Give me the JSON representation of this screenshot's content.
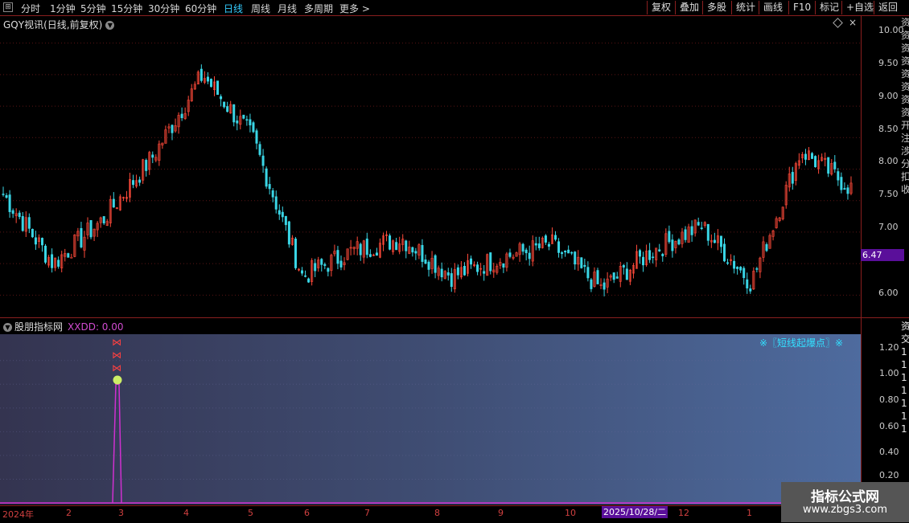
{
  "toolbar": {
    "tabs": [
      "分时",
      "1分钟",
      "5分钟",
      "15分钟",
      "30分钟",
      "60分钟",
      "日线",
      "周线",
      "月线",
      "多周期",
      "更多"
    ],
    "active_tab": "日线",
    "more_arrow": ">",
    "right_buttons": [
      "复权",
      "叠加",
      "多股",
      "统计",
      "画线",
      "F10",
      "标记",
      "+自选",
      "返回"
    ]
  },
  "main_chart": {
    "title": "GQY视讯(日线,前复权)",
    "current_price": "6.47",
    "right_strip_text": "资资资资资资资资开注涉分扣收"
  },
  "indicator": {
    "title": "股朋指标网",
    "value_label": "XXDD: 0.00",
    "signal_text": "※〖短线起爆点〗※",
    "right_strip_text": "资交1111111"
  },
  "time_axis": {
    "labels": [
      "2024年",
      "2",
      "3",
      "4",
      "5",
      "6",
      "7",
      "8",
      "9",
      "10",
      "12",
      "1"
    ],
    "cursor_date": "2025/10/28/二"
  },
  "watermark": {
    "line1": "指标公式网",
    "line2": "www.zbgs3.com"
  },
  "colors": {
    "up": "#ff4a3a",
    "down": "#3ad6e6",
    "signal_line": "#d030d0",
    "axis": "#8a1f1f",
    "tag": "#5a0f9a"
  },
  "chart_data": [
    {
      "type": "candlestick",
      "title": "GQY视讯(日线,前复权)",
      "y_ticks": [
        "10.00",
        "9.50",
        "9.00",
        "8.50",
        "8.00",
        "7.50",
        "7.00",
        "6.50",
        "6.00"
      ],
      "ylim": [
        5.8,
        10.2
      ],
      "last_price": 6.47,
      "approx_close_path": [
        {
          "t": "2024-01",
          "v": 7.6
        },
        {
          "t": "2024-02",
          "v": 6.5
        },
        {
          "t": "2024-02-mid",
          "v": 7.2
        },
        {
          "t": "2024-03-early",
          "v": 8.2
        },
        {
          "t": "2024-03-peak",
          "v": 9.5
        },
        {
          "t": "2024-03-late",
          "v": 8.5
        },
        {
          "t": "2024-04",
          "v": 6.3
        },
        {
          "t": "2024-05",
          "v": 6.7
        },
        {
          "t": "2024-06",
          "v": 6.9
        },
        {
          "t": "2024-07",
          "v": 6.3
        },
        {
          "t": "2024-08",
          "v": 6.6
        },
        {
          "t": "2024-09",
          "v": 6.8
        },
        {
          "t": "2024-10",
          "v": 6.1
        },
        {
          "t": "2024-11",
          "v": 6.7
        },
        {
          "t": "2024-12",
          "v": 7.1
        },
        {
          "t": "2024-12-late",
          "v": 6.2
        },
        {
          "t": "2025-01",
          "v": 8.3
        },
        {
          "t": "2025-01-late",
          "v": 7.7
        }
      ]
    },
    {
      "type": "line",
      "title": "股朋指标网",
      "series": [
        {
          "name": "XXDD",
          "values": [
            0,
            0,
            0,
            1,
            0,
            0,
            0,
            0,
            0,
            0,
            0,
            0,
            0,
            0,
            0,
            0,
            0,
            0
          ]
        }
      ],
      "y_ticks": [
        "1.20",
        "1.00",
        "0.80",
        "0.60",
        "0.40",
        "0.20"
      ],
      "ylim": [
        0,
        1.3
      ],
      "signal_markers": 4
    }
  ]
}
